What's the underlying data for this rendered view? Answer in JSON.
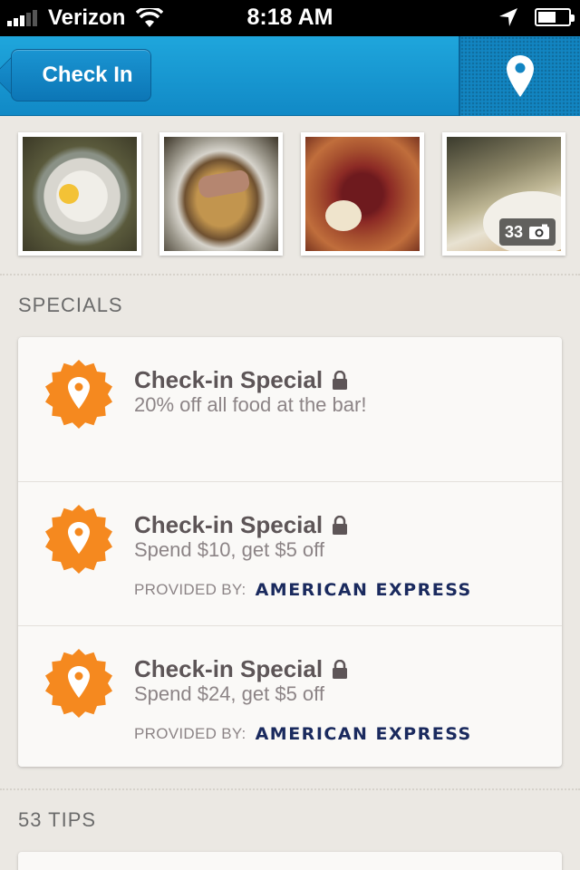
{
  "status_bar": {
    "carrier": "Verizon",
    "time": "8:18 AM",
    "signal_bars": 3,
    "battery_level": 0.6
  },
  "nav": {
    "back_label": "Check In",
    "map_icon": "map-pin-icon"
  },
  "photos": {
    "count_label": "33"
  },
  "specials": {
    "section_title": "SPECIALS",
    "items": [
      {
        "title": "Check-in Special",
        "description": "20% off all food at the bar!",
        "provided_label": "",
        "provider": ""
      },
      {
        "title": "Check-in Special",
        "description": "Spend $10, get $5 off",
        "provided_label": "PROVIDED BY:",
        "provider": "AMERICAN EXPRESS"
      },
      {
        "title": "Check-in Special",
        "description": "Spend $24, get $5 off",
        "provided_label": "PROVIDED BY:",
        "provider": "AMERICAN EXPRESS"
      }
    ]
  },
  "tips": {
    "section_title": "53 TIPS"
  },
  "colors": {
    "nav_blue": "#1a9ad6",
    "badge_orange": "#f5891f",
    "amex_navy": "#1a2a5e"
  }
}
